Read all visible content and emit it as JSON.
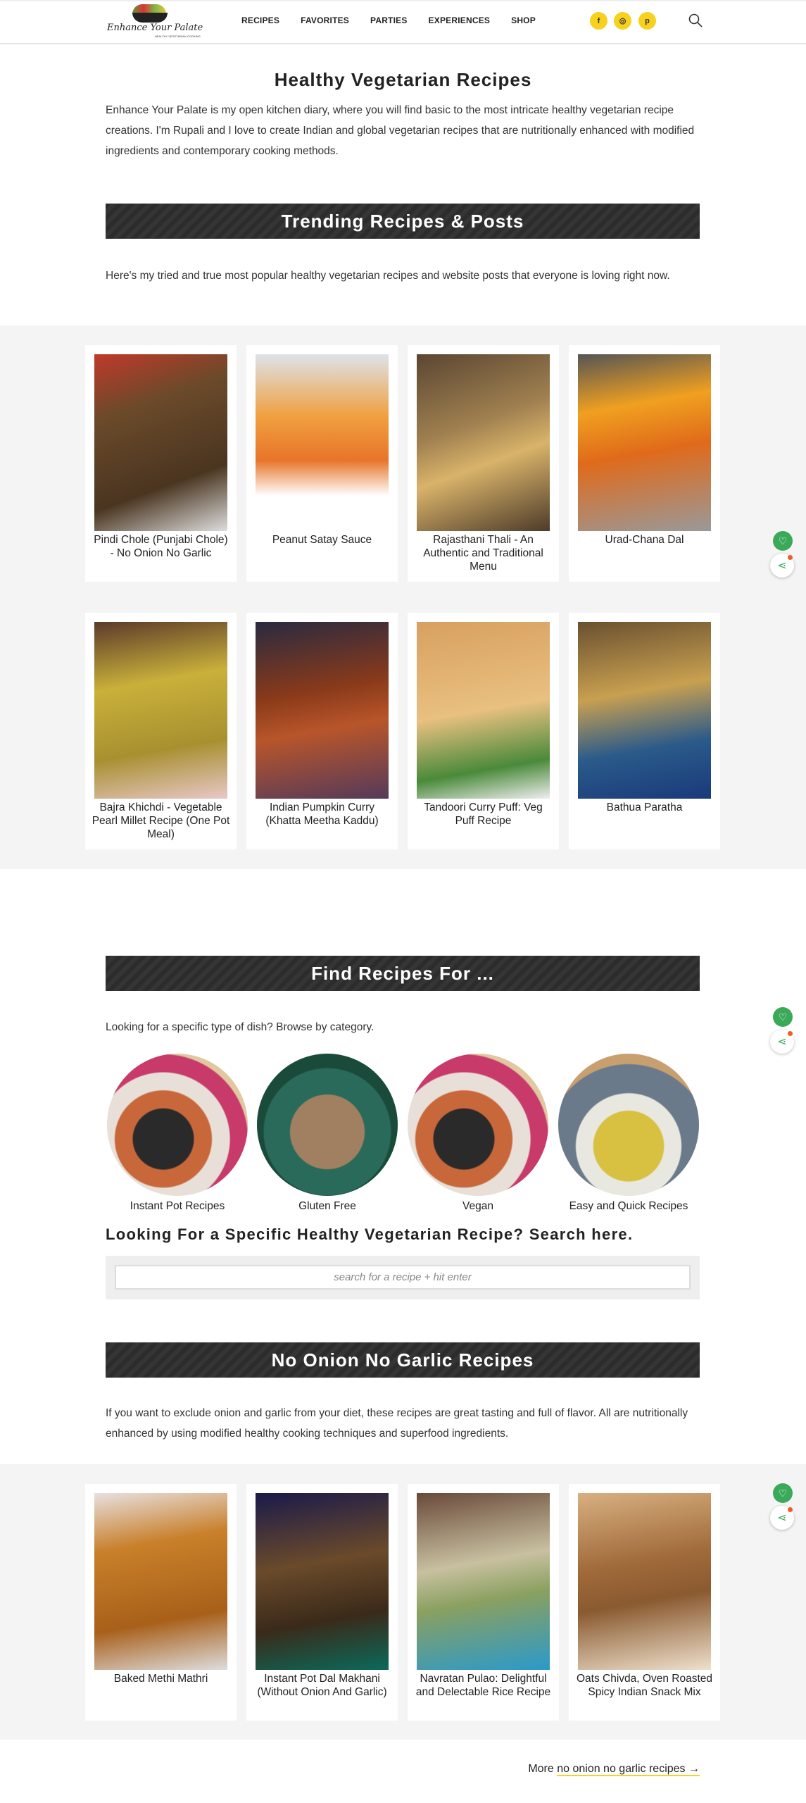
{
  "header": {
    "logo_text": "Enhance Your Palate",
    "logo_sub": "HEALTHY VEGETARIAN COOKING",
    "nav": [
      "RECIPES",
      "FAVORITES",
      "PARTIES",
      "EXPERIENCES",
      "SHOP"
    ],
    "social": [
      {
        "icon": "facebook-icon",
        "glyph": "f"
      },
      {
        "icon": "instagram-icon",
        "glyph": "◎"
      },
      {
        "icon": "pinterest-icon",
        "glyph": "p"
      }
    ]
  },
  "intro": {
    "title": "Healthy Vegetarian Recipes",
    "text": "Enhance Your Palate is my open kitchen diary, where you will find basic to the most intricate healthy vegetarian recipe creations. I'm Rupali and I love to create Indian and global vegetarian recipes that are nutritionally enhanced with modified ingredients and contemporary cooking methods."
  },
  "trending": {
    "title": "Trending Recipes & Posts",
    "text": "Here's my tried and true most popular healthy vegetarian recipes and website posts that everyone is loving right now.",
    "cards": [
      "Pindi Chole (Punjabi Chole) - No Onion No Garlic",
      "Peanut Satay Sauce",
      "Rajasthani Thali - An Authentic and Traditional Menu",
      "Urad-Chana Dal",
      "Bajra Khichdi - Vegetable Pearl Millet Recipe (One Pot Meal)",
      "Indian Pumpkin Curry (Khatta Meetha Kaddu)",
      "Tandoori Curry Puff: Veg Puff Recipe",
      "Bathua Paratha"
    ]
  },
  "find": {
    "title": "Find Recipes For ...",
    "text": "Looking for a specific type of dish? Browse by category.",
    "categories": [
      "Instant Pot Recipes",
      "Gluten Free",
      "Vegan",
      "Easy and Quick Recipes"
    ]
  },
  "search": {
    "heading": "Looking For a Specific Healthy Vegetarian Recipe? Search here.",
    "placeholder": "search for a recipe + hit enter"
  },
  "nong": {
    "title": "No Onion No Garlic Recipes",
    "text": "If you want to exclude onion and garlic from your diet, these recipes are great tasting and full of flavor. All are nutritionally enhanced by using modified healthy cooking techniques and superfood ingredients.",
    "cards": [
      "Baked Methi Mathri",
      "Instant Pot Dal Makhani (Without Onion And Garlic)",
      "Navratan Pulao: Delightful and Delectable Rice Recipe",
      "Oats Chivda, Oven Roasted Spicy Indian Snack Mix"
    ],
    "more_prefix": "More ",
    "more_link": "no onion no garlic recipes →"
  },
  "colors": {
    "accent": "#f7d11e",
    "banner": "#2c2c2c",
    "section_bg": "#f4f4f4",
    "float_green": "#3aaa5a"
  }
}
